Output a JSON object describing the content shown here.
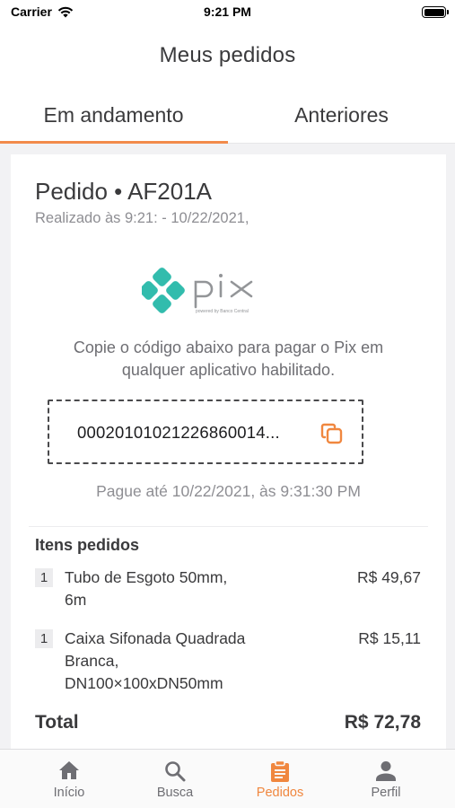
{
  "status_bar": {
    "carrier": "Carrier",
    "time": "9:21 PM"
  },
  "header": {
    "title": "Meus pedidos"
  },
  "tabs": [
    {
      "label": "Em andamento",
      "active": true
    },
    {
      "label": "Anteriores",
      "active": false
    }
  ],
  "order": {
    "title": "Pedido • AF201A",
    "placed_at": "Realizado às 9:21: - 10/22/2021,"
  },
  "pix": {
    "logo_text": "pix",
    "logo_caption": "powered by Banco Central",
    "instructions_line1": "Copie o código abaixo para pagar o Pix em",
    "instructions_line2": "qualquer aplicativo habilitado.",
    "code": "00020101021226860014...",
    "copy_icon": "copy-icon",
    "pay_until": "Pague até 10/22/2021, às 9:31:30 PM"
  },
  "items": {
    "title": "Itens pedidos",
    "list": [
      {
        "qty": "1",
        "name_line1": "Tubo de Esgoto 50mm,",
        "name_line2": "6m",
        "name_line3": "",
        "price": "R$ 49,67"
      },
      {
        "qty": "1",
        "name_line1": "Caixa Sifonada Quadrada",
        "name_line2": "Branca,",
        "name_line3": "DN100×100xDN50mm",
        "price": "R$ 15,11"
      }
    ]
  },
  "total": {
    "label": "Total",
    "value": "R$ 72,78"
  },
  "tab_bar": [
    {
      "label": "Início",
      "icon": "home-icon",
      "active": false
    },
    {
      "label": "Busca",
      "icon": "search-icon",
      "active": false
    },
    {
      "label": "Pedidos",
      "icon": "orders-icon",
      "active": true
    },
    {
      "label": "Perfil",
      "icon": "profile-icon",
      "active": false
    }
  ],
  "colors": {
    "accent": "#f0873f",
    "pix_teal": "#32bcad",
    "pix_gray": "#939598"
  }
}
